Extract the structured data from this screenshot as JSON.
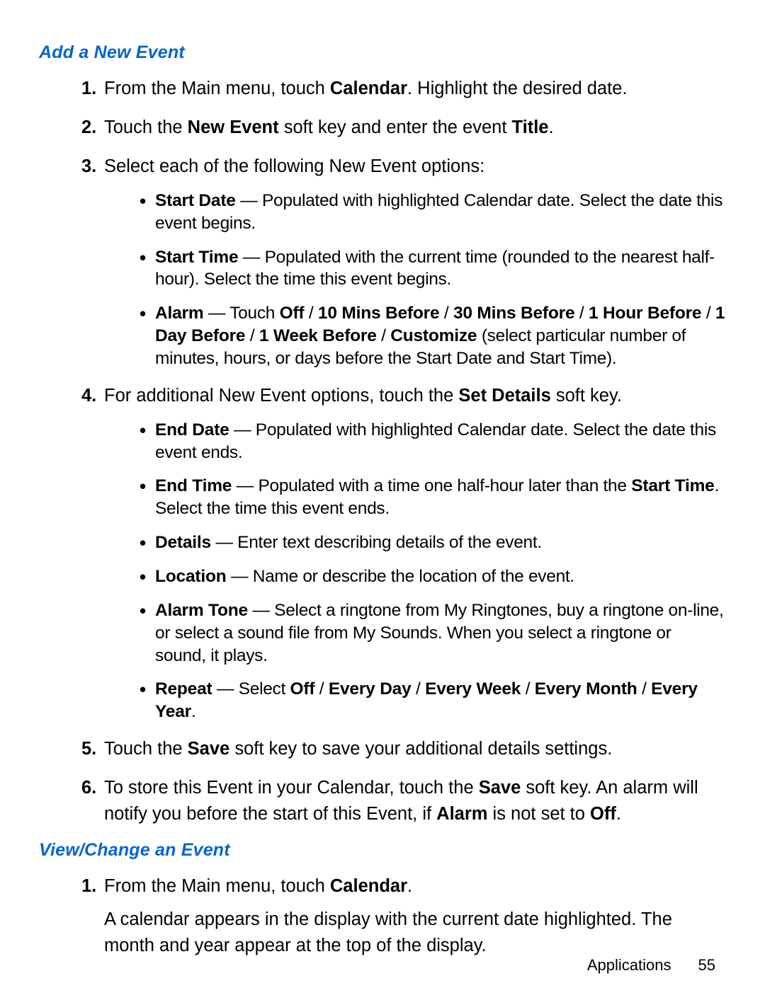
{
  "headings": {
    "addNewEvent": "Add a New Event",
    "viewChangeEvent": "View/Change an Event"
  },
  "nums": {
    "n1": "1.",
    "n2": "2.",
    "n3": "3.",
    "n4": "4.",
    "n5": "5.",
    "n6": "6."
  },
  "bullets": {
    "bull": "•"
  },
  "add": {
    "step1_a": "From the Main menu, touch ",
    "step1_b": "Calendar",
    "step1_c": ". Highlight the desired date.",
    "step2_a": "Touch the ",
    "step2_b": "New Event",
    "step2_c": " soft key and enter the event ",
    "step2_d": "Title",
    "step2_e": ".",
    "step3": "Select each of the following New Event options:",
    "opt_startdate_label": "Start Date",
    "opt_startdate_text": " — Populated with highlighted Calendar date. Select the date this event begins.",
    "opt_starttime_label": "Start Time",
    "opt_starttime_text": " — Populated with the current time (rounded to the nearest half-hour). Select the time this event begins.",
    "opt_alarm_label": "Alarm",
    "opt_alarm_a": " — Touch ",
    "opt_alarm_b": "Off",
    "opt_alarm_c": " / ",
    "opt_alarm_d": "10 Mins Before",
    "opt_alarm_e": " / ",
    "opt_alarm_f": "30 Mins Before",
    "opt_alarm_g": " / ",
    "opt_alarm_h": "1 Hour Before",
    "opt_alarm_i": " / ",
    "opt_alarm_j": "1 Day Before",
    "opt_alarm_k": " / ",
    "opt_alarm_l": "1 Week Before",
    "opt_alarm_m": " / ",
    "opt_alarm_n": "Customize",
    "opt_alarm_o": " (select particular number of minutes, hours, or days before the Start Date and Start Time).",
    "step4_a": "For additional New Event options, touch the ",
    "step4_b": "Set Details",
    "step4_c": " soft key.",
    "opt_enddate_label": "End Date",
    "opt_enddate_text": " — Populated with highlighted Calendar date. Select the date this event ends.",
    "opt_endtime_label": "End Time",
    "opt_endtime_a": " — Populated with a time one half-hour later than the ",
    "opt_endtime_b": "Start Time",
    "opt_endtime_c": ". Select the time this event ends.",
    "opt_details_label": "Details",
    "opt_details_text": " — Enter text describing details of the event.",
    "opt_location_label": "Location",
    "opt_location_text": " — Name or describe the location of the event.",
    "opt_alarmtone_label": "Alarm Tone",
    "opt_alarmtone_text": " — Select a ringtone from My Ringtones, buy a ringtone on-line, or select a sound file from My Sounds. When you select a ringtone or sound, it plays.",
    "opt_repeat_label": "Repeat",
    "opt_repeat_a": " — Select ",
    "opt_repeat_b": "Off",
    "opt_repeat_c": " / ",
    "opt_repeat_d": "Every Day",
    "opt_repeat_e": " / ",
    "opt_repeat_f": "Every Week",
    "opt_repeat_g": " / ",
    "opt_repeat_h": "Every Month",
    "opt_repeat_i": " / ",
    "opt_repeat_j": "Every Year",
    "opt_repeat_k": ".",
    "step5_a": "Touch the ",
    "step5_b": "Save",
    "step5_c": " soft key to save your additional details settings.",
    "step6_a": "To store this Event in your Calendar, touch the ",
    "step6_b": "Save",
    "step6_c": " soft key. An alarm will notify you before the start of this Event, if ",
    "step6_d": "Alarm",
    "step6_e": " is not set to ",
    "step6_f": "Off",
    "step6_g": "."
  },
  "view": {
    "step1_a": "From the Main menu, touch ",
    "step1_b": "Calendar",
    "step1_c": ".",
    "para": "A calendar appears in the display with the current date highlighted. The month and year appear at the top of the display."
  },
  "footer": {
    "section": "Applications",
    "page": "55"
  }
}
